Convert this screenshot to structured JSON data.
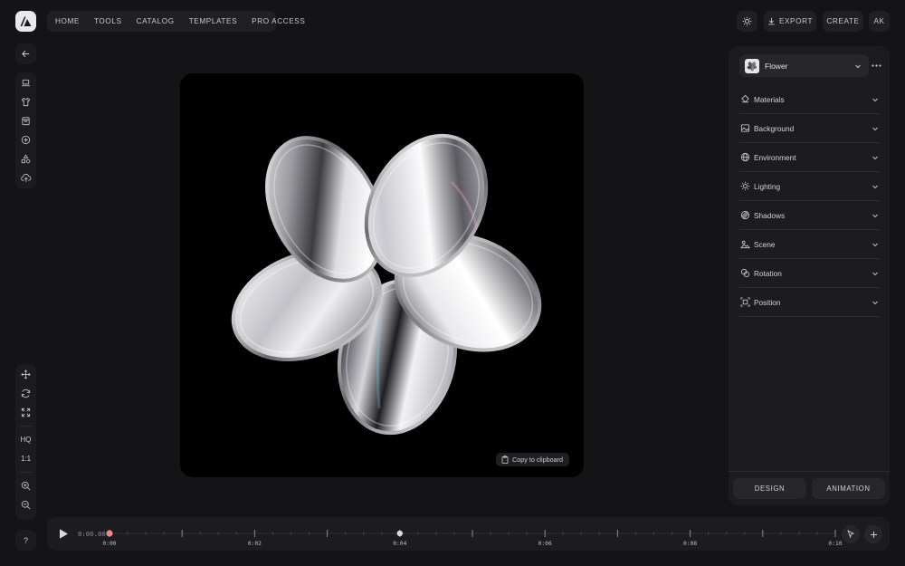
{
  "app": {
    "logo_icon": "app-logo-icon"
  },
  "nav": {
    "items": [
      {
        "label": "HOME"
      },
      {
        "label": "TOOLS"
      },
      {
        "label": "CATALOG"
      },
      {
        "label": "TEMPLATES"
      },
      {
        "label": "PRO ACCESS"
      }
    ]
  },
  "toolbar": {
    "theme_icon": "sun-icon",
    "export_label": "EXPORT",
    "create_label": "CREATE",
    "avatar_initials": "AK"
  },
  "left_rail": {
    "back_icon": "arrow-left-icon",
    "tools": [
      "laptop-icon",
      "tshirt-icon",
      "bag-icon",
      "plus-circle-icon",
      "shapes-icon",
      "upload-cloud-icon"
    ],
    "view_tools": [
      "move-icon",
      "rotate-icon",
      "expand-icon"
    ],
    "quality_label": "HQ",
    "ratio_label": "1:1",
    "zoom_tools": [
      "zoom-in-icon",
      "zoom-out-icon"
    ]
  },
  "canvas": {
    "copy_label": "Copy to clipboard"
  },
  "panel": {
    "object_label": "Flower",
    "sections": [
      {
        "label": "Materials",
        "icon": "materials-icon"
      },
      {
        "label": "Background",
        "icon": "image-icon"
      },
      {
        "label": "Environment",
        "icon": "globe-icon"
      },
      {
        "label": "Lighting",
        "icon": "sun-icon"
      },
      {
        "label": "Shadows",
        "icon": "shadow-icon"
      },
      {
        "label": "Scene",
        "icon": "scene-icon"
      },
      {
        "label": "Rotation",
        "icon": "rotation-icon"
      },
      {
        "label": "Position",
        "icon": "position-icon"
      }
    ],
    "tabs": [
      {
        "label": "DESIGN"
      },
      {
        "label": "ANIMATION"
      }
    ]
  },
  "help": {
    "label": "?"
  },
  "timeline": {
    "time": "0:00.00",
    "labels": [
      "0:00",
      "0:02",
      "0:04",
      "0:06",
      "0:08",
      "0:10"
    ],
    "playhead_seconds": 0,
    "keyframe_seconds": 4,
    "duration_seconds": 10,
    "accent": "#e98a8a"
  }
}
